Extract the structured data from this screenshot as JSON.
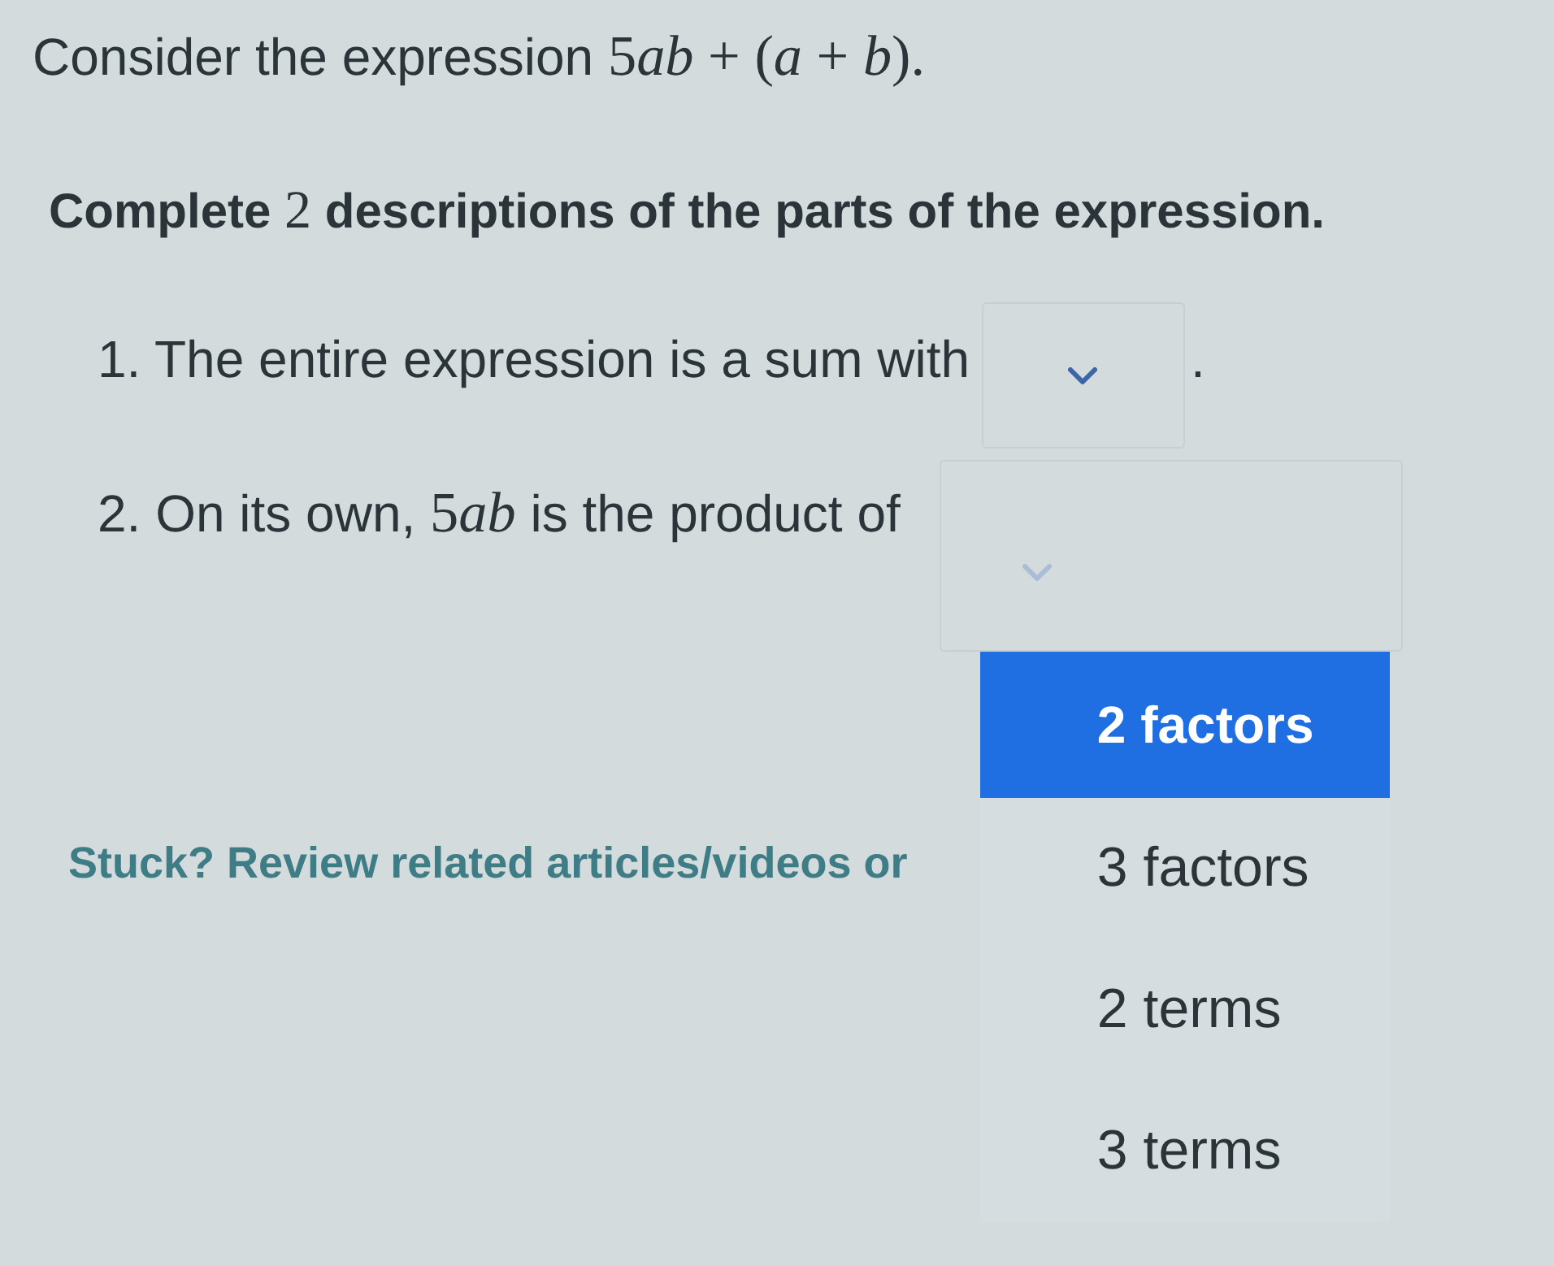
{
  "prompt": {
    "segments": [
      {
        "kind": "text",
        "text": "Consider the expression"
      },
      {
        "kind": "math",
        "tokens": [
          {
            "kind": "num",
            "text": "5"
          },
          {
            "kind": "var",
            "text": "ab"
          },
          {
            "kind": "op",
            "text": " + ("
          },
          {
            "kind": "var",
            "text": "a"
          },
          {
            "kind": "op",
            "text": " + "
          },
          {
            "kind": "var",
            "text": "b"
          },
          {
            "kind": "op",
            "text": ")."
          }
        ]
      }
    ]
  },
  "instruction": {
    "segments": [
      {
        "kind": "text",
        "text": "Complete"
      },
      {
        "kind": "math",
        "tokens": [
          {
            "kind": "num",
            "text": "2"
          }
        ]
      },
      {
        "kind": "text",
        "text": "descriptions of the parts of the expression."
      }
    ]
  },
  "questions": [
    {
      "segments": [
        {
          "kind": "text",
          "text": "1. The entire expression is a sum with"
        }
      ],
      "dropdown": {
        "expanded": false
      },
      "suffix": "."
    },
    {
      "segments": [
        {
          "kind": "text",
          "text": "2. On its own,"
        },
        {
          "kind": "math",
          "tokens": [
            {
              "kind": "num",
              "text": "5"
            },
            {
              "kind": "var",
              "text": "ab"
            }
          ]
        },
        {
          "kind": "text",
          "text": "is the product of"
        }
      ],
      "dropdown": {
        "expanded": true,
        "options": [
          {
            "label": "2 factors",
            "selected": true
          },
          {
            "label": "3 factors",
            "selected": false
          },
          {
            "label": "2 terms",
            "selected": false
          },
          {
            "label": "3 terms",
            "selected": false
          }
        ]
      }
    }
  ],
  "help": {
    "text": "Stuck? Review related articles/videos or"
  }
}
